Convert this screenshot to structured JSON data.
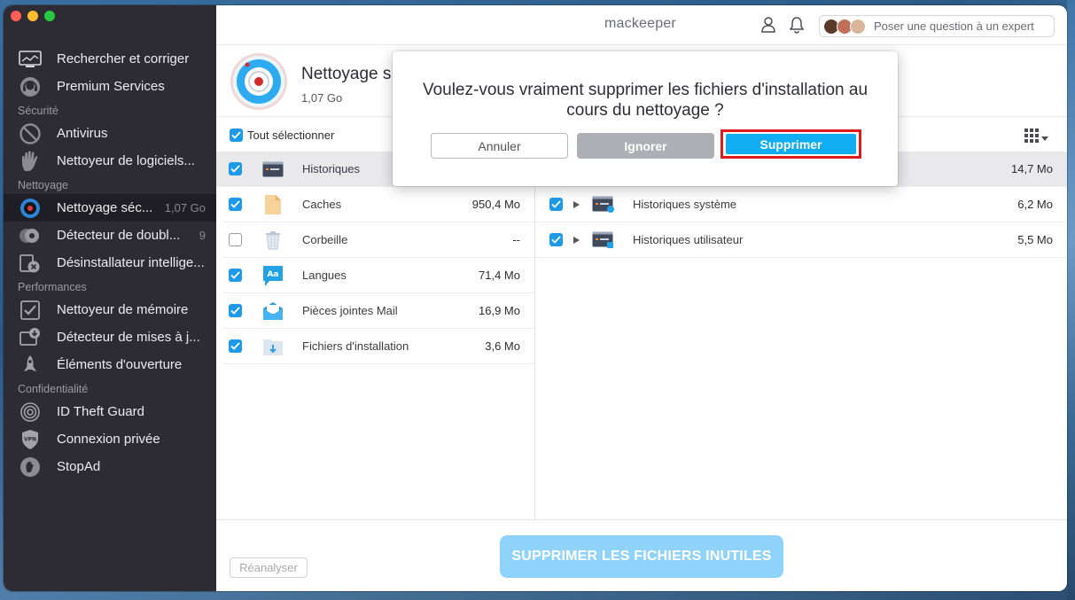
{
  "app": {
    "logo": "mackeeper"
  },
  "topbar": {
    "expert_label": "Poser une question à un expert"
  },
  "sidebar": {
    "items_top": [
      {
        "label": "Rechercher et corriger",
        "icon": "monitor-scan-icon"
      },
      {
        "label": "Premium Services",
        "icon": "headset-icon"
      }
    ],
    "section_security": "Sécurité",
    "items_security": [
      {
        "label": "Antivirus",
        "icon": "antivirus-icon"
      },
      {
        "label": "Nettoyeur de logiciels...",
        "icon": "hand-stop-icon"
      }
    ],
    "section_cleaning": "Nettoyage",
    "items_cleaning": [
      {
        "label": "Nettoyage séc...",
        "badge": "1,07 Go",
        "icon": "safe-cleanup-icon"
      },
      {
        "label": "Détecteur de doubl...",
        "badge": "9",
        "icon": "duplicates-icon"
      },
      {
        "label": "Désinstallateur intellige...",
        "icon": "uninstaller-icon"
      }
    ],
    "section_performance": "Performances",
    "items_performance": [
      {
        "label": "Nettoyeur de mémoire",
        "icon": "memory-icon"
      },
      {
        "label": "Détecteur de mises à j...",
        "icon": "updates-icon"
      },
      {
        "label": "Éléments d'ouverture",
        "icon": "rocket-icon"
      }
    ],
    "section_privacy": "Confidentialité",
    "items_privacy": [
      {
        "label": "ID Theft Guard",
        "icon": "fingerprint-icon"
      },
      {
        "label": "Connexion privée",
        "icon": "vpn-shield-icon"
      },
      {
        "label": "StopAd",
        "icon": "stopad-hand-icon"
      }
    ]
  },
  "header": {
    "title": "Nettoyage s",
    "size": "1,07 Go"
  },
  "list": {
    "select_all": "Tout sélectionner",
    "left": [
      {
        "label": "Historiques",
        "size": "",
        "checked": true
      },
      {
        "label": "Caches",
        "size": "950,4 Mo",
        "checked": true
      },
      {
        "label": "Corbeille",
        "size": "--",
        "checked": false
      },
      {
        "label": "Langues",
        "size": "71,4 Mo",
        "checked": true
      },
      {
        "label": "Pièces jointes Mail",
        "size": "16,9 Mo",
        "checked": true
      },
      {
        "label": "Fichiers d'installation",
        "size": "3,6 Mo",
        "checked": true
      }
    ],
    "right": [
      {
        "label": "",
        "size": "14,7 Mo"
      },
      {
        "label": "Historiques système",
        "size": "6,2 Mo"
      },
      {
        "label": "Historiques utilisateur",
        "size": "5,5 Mo"
      }
    ]
  },
  "footer": {
    "rescan": "Réanalyser",
    "main_action": "SUPPRIMER LES FICHIERS INUTILES"
  },
  "dialog": {
    "message": "Voulez-vous vraiment supprimer les fichiers d'installation au cours du nettoyage ?",
    "cancel": "Annuler",
    "ignore": "Ignorer",
    "delete": "Supprimer"
  },
  "colors": {
    "accent": "#10adf3",
    "highlight": "#e01b1b",
    "sidebar": "#2d2c35"
  }
}
